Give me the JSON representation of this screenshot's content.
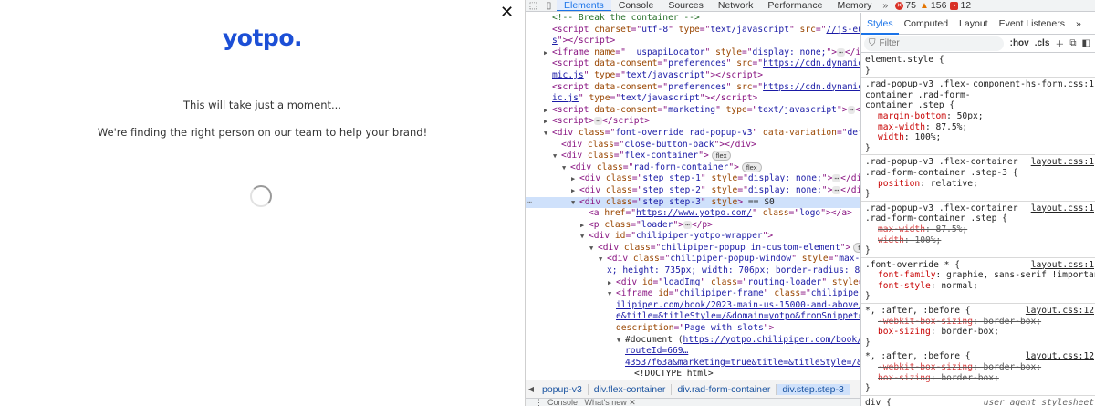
{
  "page": {
    "logo": "yotpo.",
    "close_symbol": "✕",
    "message_1": "This will take just a moment...",
    "message_2": "We're finding the right person on our team to help your brand!"
  },
  "devtools": {
    "tabs": [
      "Elements",
      "Console",
      "Sources",
      "Network",
      "Performance",
      "Memory"
    ],
    "active_tab": "Elements",
    "more_tabs": "»",
    "errors": "75",
    "warnings": "156",
    "messages": "12",
    "tree_lines": [
      {
        "ind": 2,
        "tri": "",
        "html": "<span class='c'>&lt;!-- Break the container --&gt;</span>"
      },
      {
        "ind": 2,
        "tri": "",
        "html": "<span class='t'>&lt;script</span> <span class='a'>charset</span>=\"<span class='v'>utf-8</span>\" <span class='a'>type</span>=\"<span class='v'>text/javascript</span>\" <span class='a'>src</span>=\"<span class='lnk'>//js-eu1.hsfo</span>"
      },
      {
        "ind": 2,
        "tri": "",
        "html": "<span class='lnk'>s</span>\"<span class='t'>&gt;&lt;/script&gt;</span>"
      },
      {
        "ind": 2,
        "tri": "▶",
        "html": "<span class='t'>&lt;iframe</span> <span class='a'>name</span>=\"<span class='v'>__uspapiLocator</span>\" <span class='a'>style</span>=\"<span class='v'>display: none;</span>\"<span class='t'>&gt;</span><span class='ell'>⋯</span><span class='t'>&lt;/iframe</span>"
      },
      {
        "ind": 2,
        "tri": "",
        "html": "<span class='t'>&lt;script</span> <span class='a'>data-consent</span>=\"<span class='v'>preferences</span>\" <span class='a'>src</span>=\"<span class='lnk'>https://cdn.dynamicyield.c</span>"
      },
      {
        "ind": 2,
        "tri": "",
        "html": "<span class='lnk'>mic.js</span>\" <span class='a'>type</span>=\"<span class='v'>text/javascript</span>\"<span class='t'>&gt;&lt;/script&gt;</span>"
      },
      {
        "ind": 2,
        "tri": "",
        "html": "<span class='t'>&lt;script</span> <span class='a'>data-consent</span>=\"<span class='v'>preferences</span>\" <span class='a'>src</span>=\"<span class='lnk'>https://cdn.dynamicyield.c</span>"
      },
      {
        "ind": 2,
        "tri": "",
        "html": "<span class='lnk'>ic.js</span>\" <span class='a'>type</span>=\"<span class='v'>text/javascript</span>\"<span class='t'>&gt;&lt;/script&gt;</span>"
      },
      {
        "ind": 2,
        "tri": "▶",
        "html": "<span class='t'>&lt;script</span> <span class='a'>data-consent</span>=\"<span class='v'>marketing</span>\" <span class='a'>type</span>=\"<span class='v'>text/javascript</span>\"<span class='t'>&gt;</span><span class='ell'>⋯</span><span class='t'>&lt;/scri</span>"
      },
      {
        "ind": 2,
        "tri": "▶",
        "html": "<span class='t'>&lt;script&gt;</span><span class='ell'>⋯</span><span class='t'>&lt;/script&gt;</span>"
      },
      {
        "ind": 2,
        "tri": "▼",
        "html": "<span class='t'>&lt;div</span> <span class='a'>class</span>=\"<span class='v'>font-override rad-popup-v3</span>\" <span class='a'>data-variation</span>=\"<span class='v'>default</span>\"<span class='t'>&gt;</span>"
      },
      {
        "ind": 3,
        "tri": "",
        "html": "<span class='t'>&lt;div</span> <span class='a'>class</span>=\"<span class='v'>close-button-back</span>\"<span class='t'>&gt;&lt;/div&gt;</span>"
      },
      {
        "ind": 3,
        "tri": "▼",
        "html": "<span class='t'>&lt;div</span> <span class='a'>class</span>=\"<span class='v'>flex-container</span>\"<span class='t'>&gt;</span><span class='bdg'>flex</span>"
      },
      {
        "ind": 4,
        "tri": "▼",
        "html": "<span class='t'>&lt;div</span> <span class='a'>class</span>=\"<span class='v'>rad-form-container</span>\"<span class='t'>&gt;</span><span class='bdg'>flex</span>"
      },
      {
        "ind": 5,
        "tri": "▶",
        "html": "<span class='t'>&lt;div</span> <span class='a'>class</span>=\"<span class='v'>step step-1</span>\" <span class='a'>style</span>=\"<span class='v'>display: none;</span>\"<span class='t'>&gt;</span><span class='ell'>⋯</span><span class='t'>&lt;/div&gt;</span>"
      },
      {
        "ind": 5,
        "tri": "▶",
        "html": "<span class='t'>&lt;div</span> <span class='a'>class</span>=\"<span class='v'>step step-2</span>\" <span class='a'>style</span>=\"<span class='v'>display: none;</span>\"<span class='t'>&gt;</span><span class='ell'>⋯</span><span class='t'>&lt;/div&gt;</span>"
      },
      {
        "ind": 5,
        "tri": "▼",
        "sel": true,
        "html": "<span class='t'>&lt;div</span> <span class='a'>class</span>=\"<span class='v'>step step-3</span>\" <span class='a'>style</span><span class='t'>&gt;</span> <span class='txt'>== $0</span>"
      },
      {
        "ind": 6,
        "tri": "",
        "html": "<span class='t'>&lt;a</span> <span class='a'>href</span>=\"<span class='lnk'>https://www.yotpo.com/</span>\" <span class='a'>class</span>=\"<span class='v'>logo</span>\"<span class='t'>&gt;&lt;/a&gt;</span>"
      },
      {
        "ind": 6,
        "tri": "▶",
        "html": "<span class='t'>&lt;p</span> <span class='a'>class</span>=\"<span class='v'>loader</span>\"<span class='t'>&gt;</span><span class='ell'>⋯</span><span class='t'>&lt;/p&gt;</span>"
      },
      {
        "ind": 6,
        "tri": "▼",
        "html": "<span class='t'>&lt;div</span> <span class='a'>id</span>=\"<span class='v'>chilipiper-yotpo-wrapper</span>\"<span class='t'>&gt;</span>"
      },
      {
        "ind": 7,
        "tri": "▼",
        "html": "<span class='t'>&lt;div</span> <span class='a'>class</span>=\"<span class='v'>chilipiper-popup in-custom-element</span>\"<span class='t'>&gt;</span><span class='bdg'>flex</span>"
      },
      {
        "ind": 8,
        "tri": "▼",
        "html": "<span class='t'>&lt;div</span> <span class='a'>class</span>=\"<span class='v'>chilipiper-popup-window</span>\" <span class='a'>style</span>=\"<span class='v'>max-width</span>"
      },
      {
        "ind": 8,
        "tri": "",
        "html": "<span class='v'>x; height: 735px; width: 706px; border-radius: 8px; b</span>"
      },
      {
        "ind": 9,
        "tri": "▶",
        "html": "<span class='t'>&lt;div</span> <span class='a'>id</span>=\"<span class='v'>loadImg</span>\" <span class='a'>class</span>=\"<span class='v'>routing-loader</span>\" <span class='a'>style</span>=\"<span class='v'>dis</span>"
      },
      {
        "ind": 9,
        "tri": "▼",
        "html": "<span class='t'>&lt;iframe</span> <span class='a'>id</span>=\"<span class='v'>chilipiper-frame</span>\" <span class='a'>class</span>=\"<span class='v'>chilipiper-fra</span>"
      },
      {
        "ind": 9,
        "tri": "",
        "html": "<span class='lnk'>ilipiper.com/book/2023-main-us-15000-and-above/?rou</span>"
      },
      {
        "ind": 9,
        "tri": "",
        "html": "<span class='lnk'>e&amp;title=&amp;titleStyle=/&amp;domain=yotpo&amp;fromSnippet=true</span>"
      },
      {
        "ind": 9,
        "tri": "",
        "html": "<span class='a'>description</span>=\"<span class='v'>Page with slots</span>\"<span class='t'>&gt;</span>"
      },
      {
        "ind": 10,
        "tri": "▼",
        "html": "<span class='txt'>#document (</span><span class='lnk'>https://yotpo.chilipiper.com/book/2023</span>"
      },
      {
        "ind": 10,
        "tri": "",
        "html": "<span class='lnk'>routeId=669…</span>"
      },
      {
        "ind": 10,
        "tri": "",
        "html": "<span class='lnk'>43537f63a&amp;marketing=true&amp;title=&amp;titleStyle=/&amp;doma</span>"
      },
      {
        "ind": 11,
        "tri": "",
        "html": "<span class='txt'>&lt;!DOCTYPE html&gt;</span>"
      }
    ],
    "breadcrumbs": [
      "popup-v3",
      "div.flex-container",
      "div.rad-form-container",
      "div.step.step-3"
    ],
    "styles_tabs": [
      "Styles",
      "Computed",
      "Layout",
      "Event Listeners",
      "»"
    ],
    "active_styles_tab": "Styles",
    "filter_placeholder": "Filter",
    "filter_toggles": [
      ":hov",
      ".cls"
    ],
    "rules": [
      {
        "selector": "element.style {",
        "source": "",
        "props": []
      },
      {
        "selector": ".rad-popup-v3 .flex-container .rad-form-container .step {",
        "source": "component-hs-form.css:1",
        "lines": [
          ".rad-popup-v3 .flex-",
          "container .rad-form-",
          "container .step {"
        ],
        "props": [
          {
            "n": "margin-bottom",
            "v": "50px;"
          },
          {
            "n": "max-width",
            "v": "87.5%;"
          },
          {
            "n": "width",
            "v": "100%;"
          }
        ]
      },
      {
        "selector": ".rad-popup-v3 .flex-container .rad-form-container .step-3 {",
        "source": "layout.css:1",
        "lines": [
          ".rad-popup-v3 .flex-container",
          ".rad-form-container .step-3 {"
        ],
        "props": [
          {
            "n": "position",
            "v": "relative;"
          }
        ]
      },
      {
        "selector": ".rad-popup-v3 .flex-container .rad-form-container .step {",
        "source": "layout.css:1",
        "lines": [
          ".rad-popup-v3 .flex-container",
          ".rad-form-container .step {"
        ],
        "props": [
          {
            "n": "max-width",
            "v": "87.5%;",
            "s": true
          },
          {
            "n": "width",
            "v": "100%;",
            "s": true
          }
        ]
      },
      {
        "selector": ".font-override * {",
        "source": "layout.css:1",
        "lines": [
          ".font-override * {"
        ],
        "props": [
          {
            "n": "font-family",
            "v": "graphie, sans-serif !important;"
          },
          {
            "n": "font-style",
            "v": "normal;"
          }
        ]
      },
      {
        "selector": "*, :after, :before {",
        "source": "layout.css:12",
        "lines": [
          "*, :after, :before {"
        ],
        "props": [
          {
            "n": "-webkit-box-sizing",
            "v": "border-box;",
            "s": true
          },
          {
            "n": "box-sizing",
            "v": "border-box;"
          }
        ]
      },
      {
        "selector": "*, :after, :before {",
        "source": "layout.css:12",
        "lines": [
          "*, :after, :before {"
        ],
        "props": [
          {
            "n": "-webkit-box-sizing",
            "v": "border-box;",
            "s": true
          },
          {
            "n": "box-sizing",
            "v": "border-box;",
            "s": true
          }
        ]
      },
      {
        "selector": "div {",
        "source": "user agent stylesheet",
        "ua": true,
        "lines": [
          "div {"
        ],
        "props": []
      }
    ]
  }
}
